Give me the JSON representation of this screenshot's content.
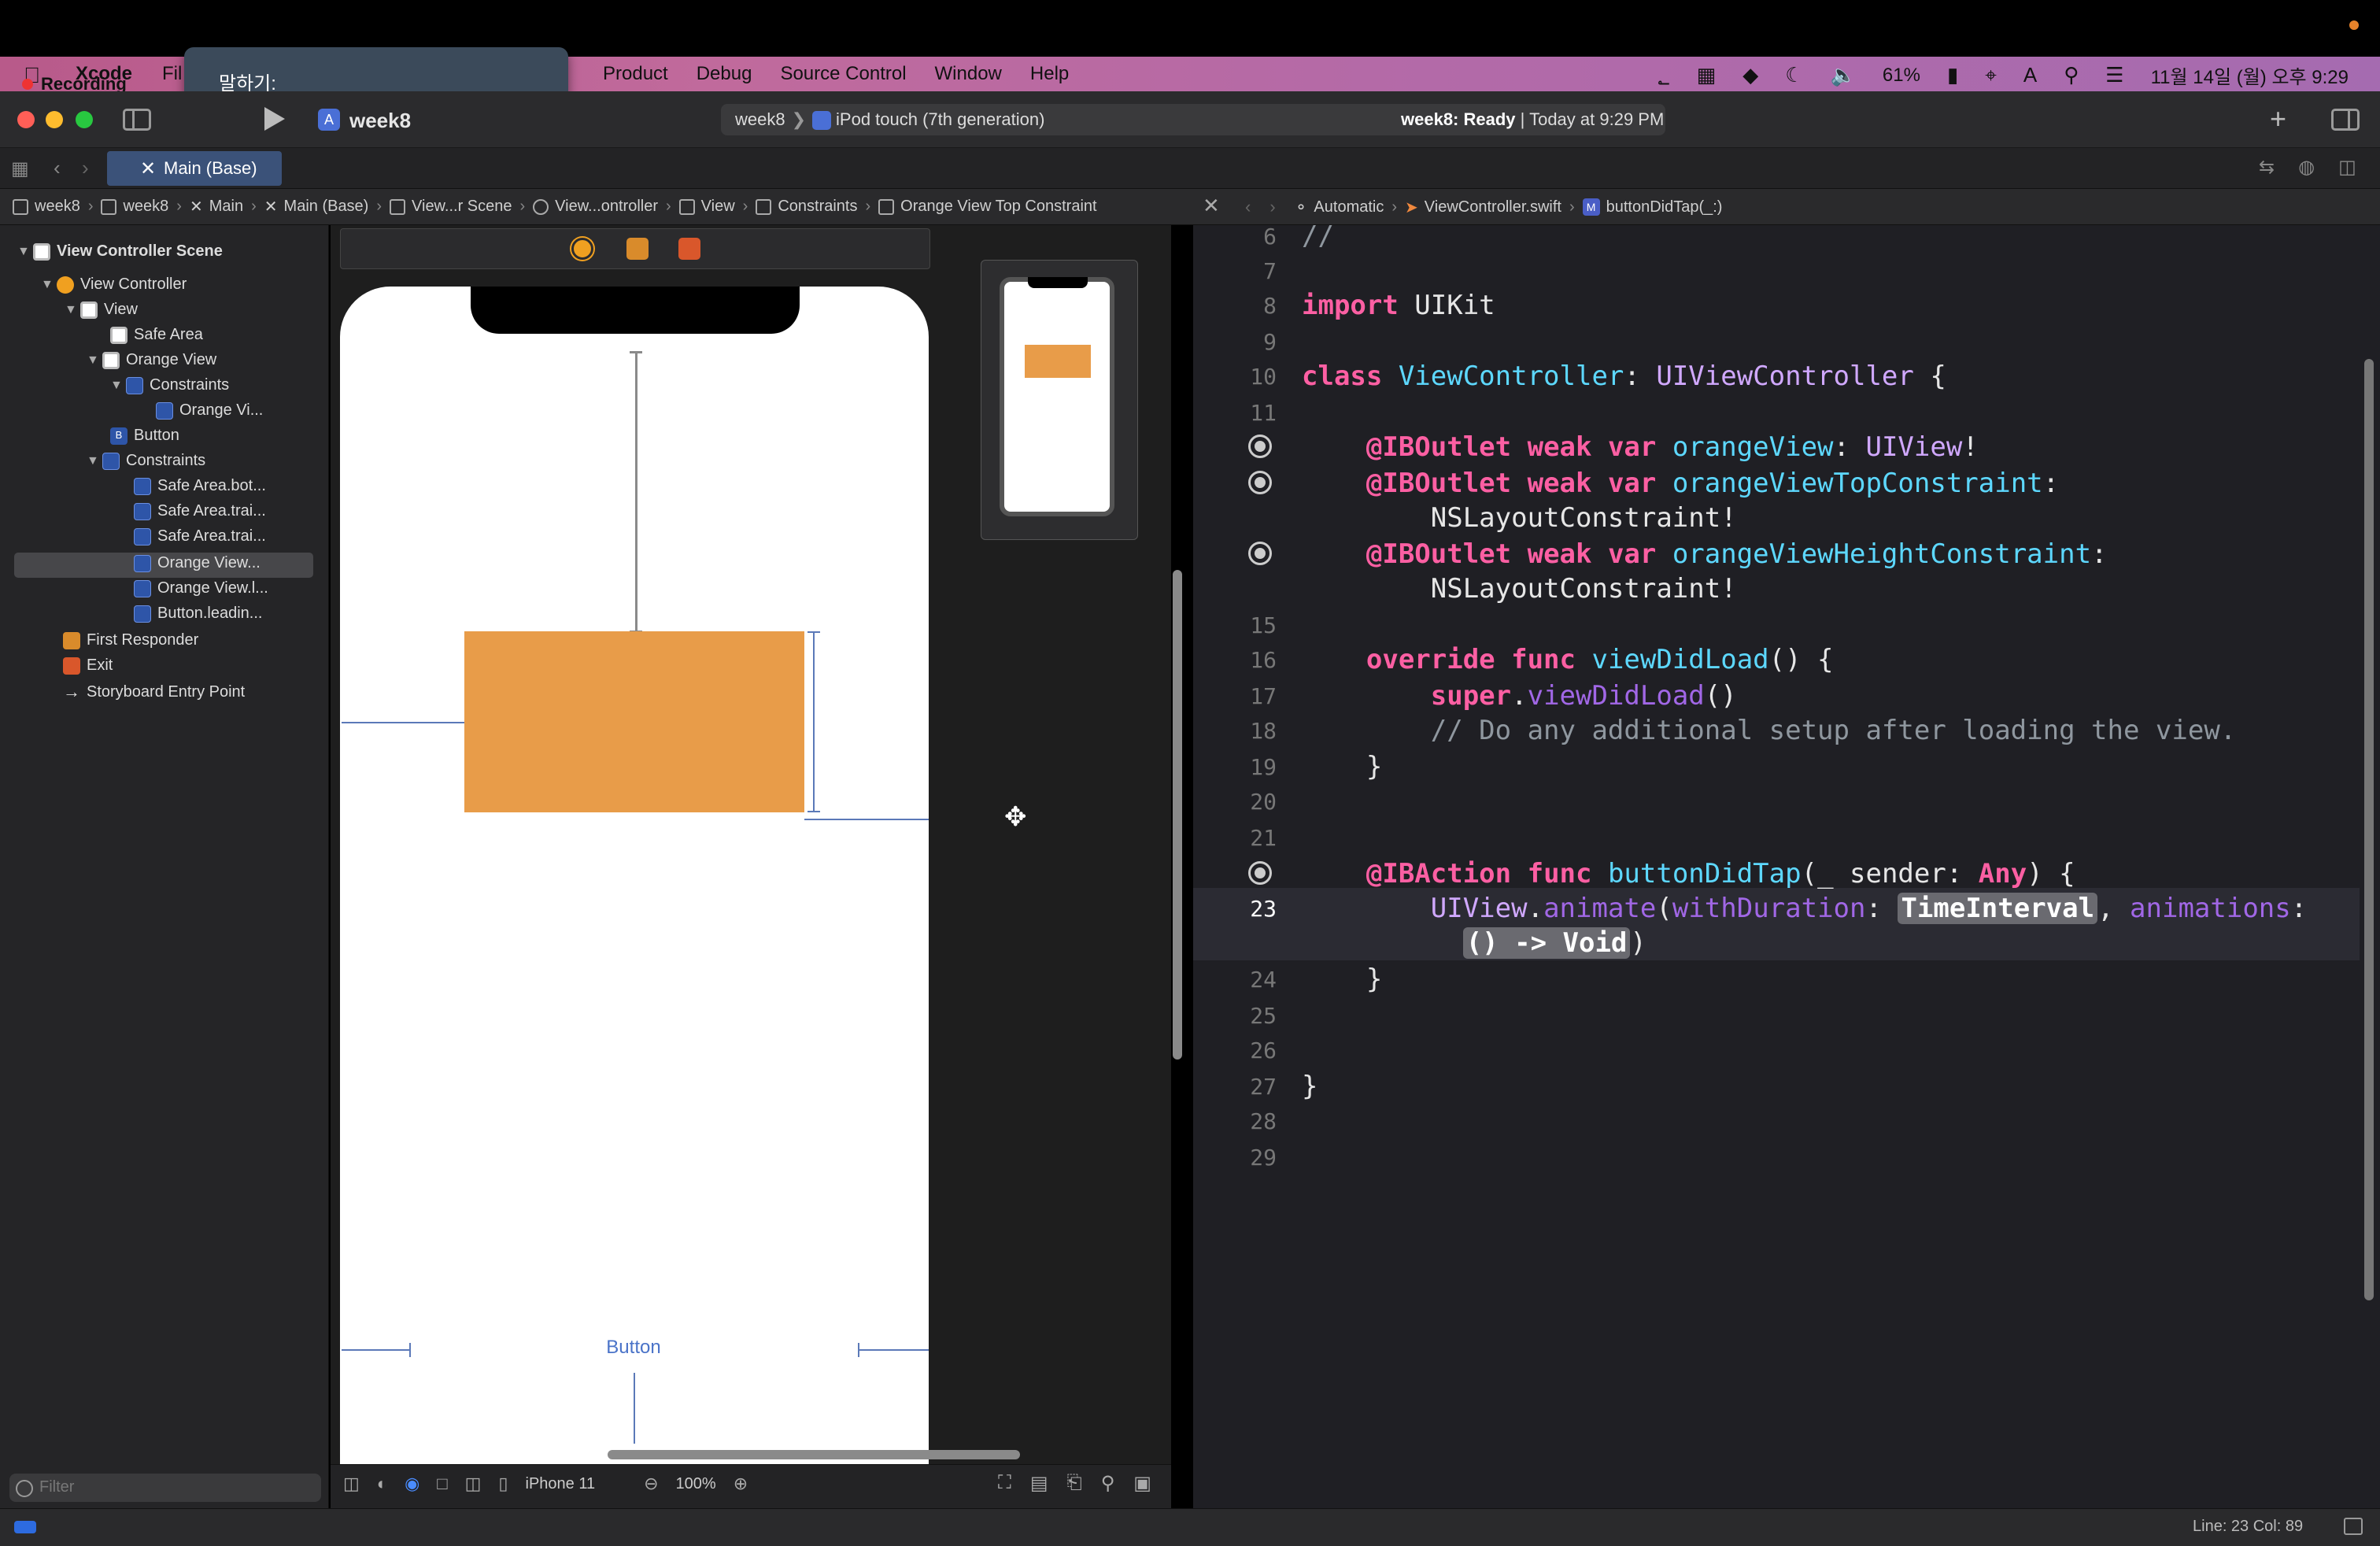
{
  "recording": {
    "label": "Recording",
    "popup_text": "말하기:"
  },
  "menubar": {
    "app": "Xcode",
    "file_partial": "Fil",
    "items": [
      "Product",
      "Debug",
      "Source Control",
      "Window",
      "Help"
    ],
    "status": {
      "battery": "61%",
      "datetime": "11월 14일 (월) 오후 9:29",
      "input_indicator": "A"
    }
  },
  "toolbar": {
    "project": "week8",
    "scheme": "week8",
    "device": "iPod touch (7th generation)",
    "build_status_bold": "week8: Ready",
    "build_status_time": "Today at 9:29 PM"
  },
  "tabs": [
    {
      "label": "Main (Base)"
    }
  ],
  "breadcrumbs": [
    "week8",
    "week8",
    "Main",
    "Main (Base)",
    "View...r Scene",
    "View...ontroller",
    "View",
    "Constraints",
    "Orange View Top Constraint"
  ],
  "editor_breadcrumbs": [
    "Automatic",
    "ViewController.swift",
    "buttonDidTap(_:)"
  ],
  "outline": [
    {
      "label": "View Controller Scene",
      "bold": true
    },
    {
      "label": "View Controller"
    },
    {
      "label": "View"
    },
    {
      "label": "Safe Area"
    },
    {
      "label": "Orange View"
    },
    {
      "label": "Constraints"
    },
    {
      "label": "Orange Vi..."
    },
    {
      "label": "Button"
    },
    {
      "label": "Constraints"
    },
    {
      "label": "Safe Area.bot..."
    },
    {
      "label": "Safe Area.trai..."
    },
    {
      "label": "Safe Area.trai..."
    },
    {
      "label": "Orange View..."
    },
    {
      "label": "Orange View.l..."
    },
    {
      "label": "Button.leadin..."
    },
    {
      "label": "First Responder"
    },
    {
      "label": "Exit"
    },
    {
      "label": "Storyboard Entry Point"
    }
  ],
  "filter": {
    "placeholder": "Filter"
  },
  "canvas": {
    "button_label": "Button",
    "device": "iPhone 11",
    "zoom": "100%"
  },
  "code": {
    "line_numbers": [
      "6",
      "7",
      "8",
      "9",
      "10",
      "11",
      "15",
      "16",
      "17",
      "18",
      "19",
      "20",
      "21",
      "23",
      "24",
      "25",
      "26",
      "27",
      "28",
      "29"
    ],
    "lines": {
      "l6": "//",
      "l8_kw": "import",
      "l8_rest": " UIKit",
      "l10_kw": "class",
      "l10_name": " ViewController",
      "l10_sep": ": ",
      "l10_super": "UIViewController",
      "l10_end": " {",
      "l12_attr": "@IBOutlet",
      "l12_kw": " weak var",
      "l12_name": " orangeView",
      "l12_sep": ": ",
      "l12_type": "UIView",
      "l12_end": "!",
      "l13_attr": "@IBOutlet",
      "l13_kw": " weak var",
      "l13_name": " orangeViewTopConstraint",
      "l13_end": ":",
      "l13b_type": "NSLayoutConstraint",
      "l13b_end": "!",
      "l14_attr": "@IBOutlet",
      "l14_kw": " weak var",
      "l14_name": " orangeViewHeightConstraint",
      "l14_end": ":",
      "l14b_type": "NSLayoutConstraint",
      "l14b_end": "!",
      "l16_kw": "override func",
      "l16_name": " viewDidLoad",
      "l16_end": "() {",
      "l17_kw": "super",
      "l17_dot": ".",
      "l17_fn": "viewDidLoad",
      "l17_end": "()",
      "l18_comment": "// Do any additional setup after loading the view.",
      "l19": "}",
      "l22_attr": "@IBAction",
      "l22_kw": " func",
      "l22_name": " buttonDidTap",
      "l22_open": "(_ sender: ",
      "l22_type": "Any",
      "l22_end": ") {",
      "l23_type": "UIView",
      "l23_dot": ".",
      "l23_fn": "animate",
      "l23_open": "(",
      "l23_label": "withDuration",
      "l23_colon": ": ",
      "l23_ph1": "TimeInterval",
      "l23_comma": ", ",
      "l23_label2": "animations",
      "l23_colon2": ":",
      "l23b_ph2": "() -> Void",
      "l23b_end": ")",
      "l24": "}",
      "l27": "}"
    }
  },
  "statusbar": {
    "line_col": "Line: 23  Col: 89"
  },
  "colors": {
    "orange_view": "#e89c49",
    "accent": "#4a73c8",
    "keyword": "#fc5fa3"
  }
}
